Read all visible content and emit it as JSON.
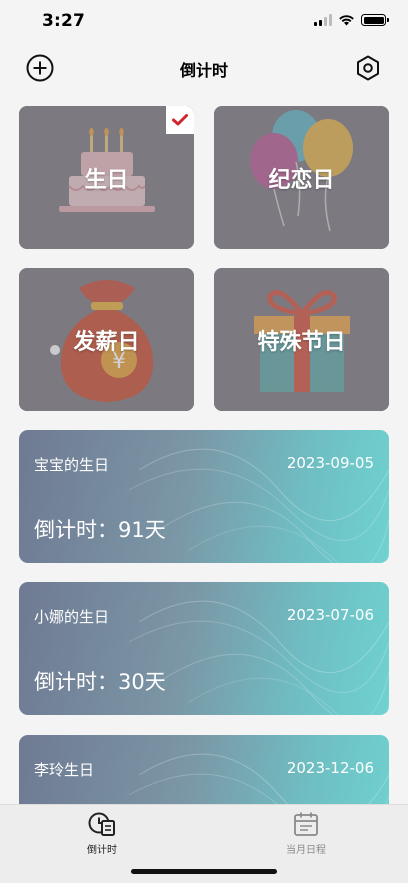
{
  "status_bar": {
    "time": "3:27"
  },
  "nav": {
    "title": "倒计时",
    "add_icon": "plus-circle-icon",
    "settings_icon": "hexagon-settings-icon"
  },
  "categories": [
    {
      "label": "生日",
      "icon": "birthday-cake-icon",
      "selected": true
    },
    {
      "label": "纪恋日",
      "icon": "balloons-icon",
      "selected": false
    },
    {
      "label": "发薪日",
      "icon": "money-bag-icon",
      "selected": false
    },
    {
      "label": "特殊节日",
      "icon": "gift-box-icon",
      "selected": false
    }
  ],
  "events": [
    {
      "name": "宝宝的生日",
      "date": "2023-09-05",
      "countdown": "倒计时：91天"
    },
    {
      "name": "小娜的生日",
      "date": "2023-07-06",
      "countdown": "倒计时：30天"
    },
    {
      "name": "李玲生日",
      "date": "2023-12-06",
      "countdown": ""
    }
  ],
  "tabs": [
    {
      "label": "倒计时",
      "icon": "countdown-calendar-icon",
      "active": true
    },
    {
      "label": "当月日程",
      "icon": "month-calendar-icon",
      "active": false
    }
  ],
  "colors": {
    "accent_check": "#d0262b",
    "tile_bg": "#7c7a80",
    "card_gradient_start": "#6f7a93",
    "card_gradient_end": "#6fd2d0"
  }
}
